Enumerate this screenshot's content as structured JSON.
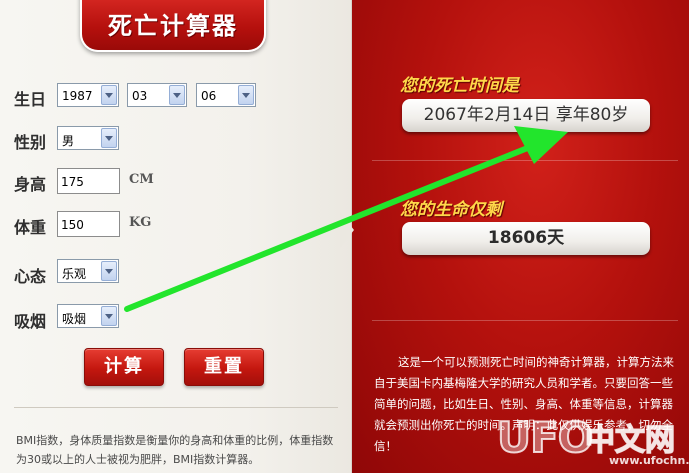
{
  "app": {
    "title": "死亡计算器"
  },
  "form": {
    "birthday": {
      "label": "生日",
      "year": "1987",
      "month": "03",
      "day": "06"
    },
    "gender": {
      "label": "性别",
      "value": "男"
    },
    "height": {
      "label": "身高",
      "value": "175",
      "unit": "CM"
    },
    "weight": {
      "label": "体重",
      "value": "150",
      "unit": "KG"
    },
    "mood": {
      "label": "心态",
      "value": "乐观"
    },
    "smoking": {
      "label": "吸烟",
      "value": "吸烟"
    },
    "calculate_label": "计算",
    "reset_label": "重置"
  },
  "bmi_note": "BMI指数，身体质量指数是衡量你的身高和体重的比例，体重指数为30或以上的人士被视为肥胖，BMI指数计算器。",
  "result": {
    "death_heading": "您的死亡时间是",
    "death_value": "2067年2月14日 享年80岁",
    "remaining_heading": "您的生命仅剩",
    "remaining_value": "18606天"
  },
  "description": "这是一个可以预测死亡时间的神奇计算器，计算方法来自于美国卡内基梅隆大学的研究人员和学者。只要回答一些简单的问题，比如生日、性别、身高、体重等信息，计算器就会预测出你死亡的时间。声明：此仅供娱乐参考，切勿全信！",
  "watermark": {
    "brand": "UFO",
    "cn": "中文网",
    "url": "www.ufochn.com"
  },
  "colors": {
    "accent_red": "#c4170f",
    "heading_yellow": "#ffd84a",
    "arrow_green": "#22e52c"
  }
}
